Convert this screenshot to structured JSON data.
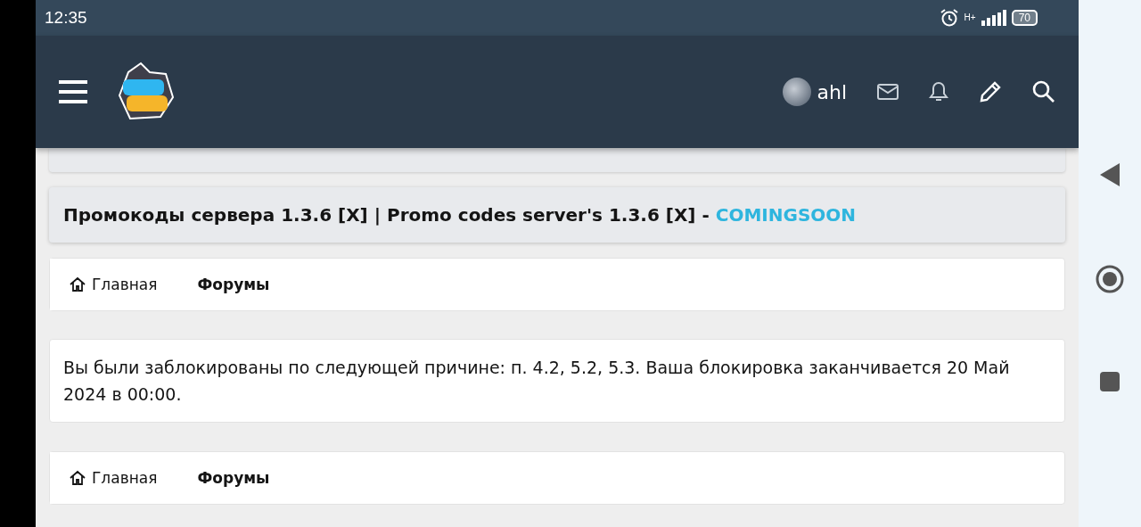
{
  "status_bar": {
    "time": "12:35",
    "network": "H+",
    "battery": "70"
  },
  "header": {
    "username": "ahl"
  },
  "promo": {
    "text": "Промокоды сервера 1.3.6 [X] | Promo codes server's 1.3.6 [X] - ",
    "highlight": "COMINGSOON"
  },
  "breadcrumbs_top": [
    {
      "label": "Главная",
      "kind": "home"
    },
    {
      "label": "Форумы",
      "kind": "current"
    }
  ],
  "notice": {
    "text": "Вы были заблокированы по следующей причине: п. 4.2, 5.2, 5.3. Ваша блокировка заканчивается 20 Май 2024 в 00:00."
  },
  "breadcrumbs_bottom": [
    {
      "label": "Главная",
      "kind": "home"
    },
    {
      "label": "Форумы",
      "kind": "current"
    }
  ]
}
